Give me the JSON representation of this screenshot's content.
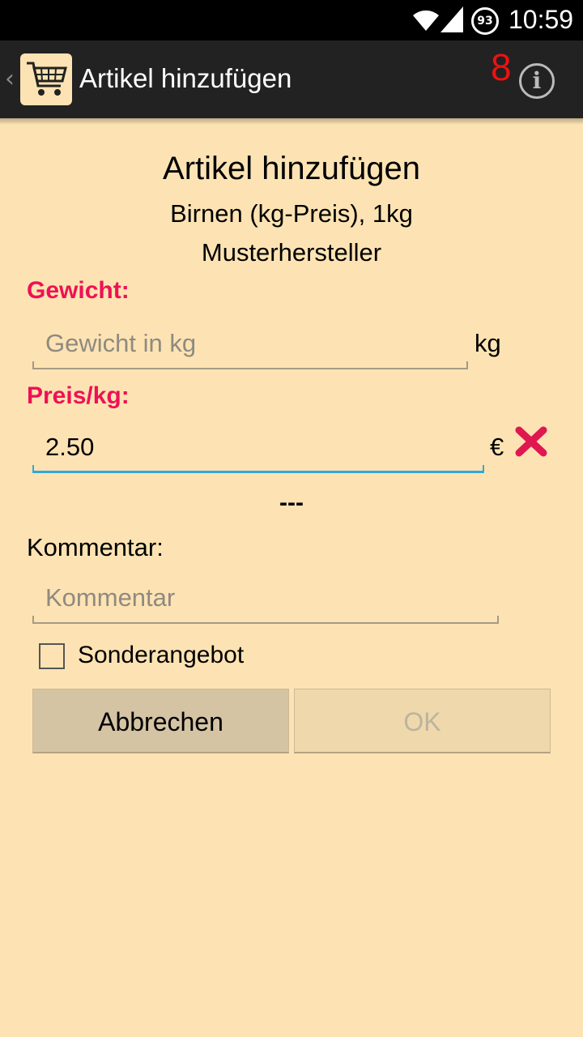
{
  "status_bar": {
    "battery": "93",
    "time": "10:59"
  },
  "action_bar": {
    "title": "Artikel hinzufügen",
    "count": "8"
  },
  "dialog": {
    "title": "Artikel hinzufügen",
    "item": "Birnen (kg-Preis), 1kg",
    "manufacturer": "Musterhersteller"
  },
  "weight": {
    "label": "Gewicht:",
    "value": "",
    "placeholder": "Gewicht in kg",
    "unit": "kg"
  },
  "price": {
    "label": "Preis/kg:",
    "value": "2.50",
    "placeholder": "",
    "unit": "€"
  },
  "separator": "---",
  "comment": {
    "label": "Kommentar:",
    "value": "",
    "placeholder": "Kommentar"
  },
  "special_offer": {
    "label": "Sonderangebot",
    "checked": false
  },
  "buttons": {
    "cancel": "Abbrechen",
    "ok": "OK"
  },
  "colors": {
    "background": "#fde3b3",
    "label_red": "#ee1155",
    "active_underline": "#33a7d8",
    "count_red": "#ee1111"
  }
}
